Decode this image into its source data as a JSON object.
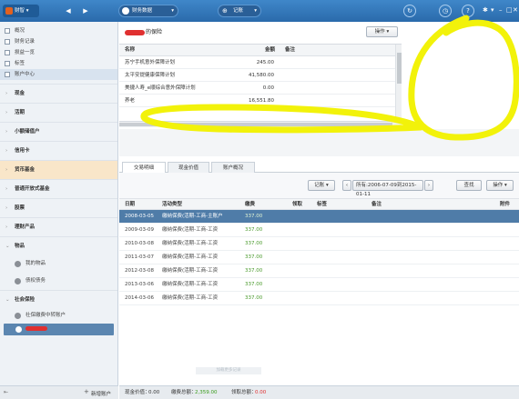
{
  "topbar": {
    "app_name": "财智",
    "workspace": "财务数据",
    "record": "记账",
    "colors": {
      "bar": "#3278bd",
      "accent": "#e2611f"
    }
  },
  "sidebar": {
    "top_items": [
      {
        "label": "概况",
        "icon": "overview-icon"
      },
      {
        "label": "财务记录",
        "icon": "records-icon"
      },
      {
        "label": "损益一览",
        "icon": "profit-icon"
      },
      {
        "label": "标签",
        "icon": "tag-icon"
      },
      {
        "label": "账户中心",
        "icon": "account-center-icon"
      }
    ],
    "groups": [
      {
        "label": "现金"
      },
      {
        "label": "活期"
      },
      {
        "label": "小额储值户"
      },
      {
        "label": "信用卡"
      },
      {
        "label": "货币基金"
      },
      {
        "label": "普通开放式基金"
      },
      {
        "label": "股票"
      },
      {
        "label": "理财产品"
      }
    ],
    "goods_group": {
      "label": "物品",
      "items": [
        "我的物品",
        "债权债务"
      ]
    },
    "social_group": {
      "label": "社会保险",
      "items": [
        "社保缴费中转账户"
      ]
    },
    "footer_add": "新增账户"
  },
  "account_panel": {
    "title_suffix": "的保险",
    "action_button": "操作",
    "columns": [
      "名称",
      "金额",
      "备注"
    ],
    "rows": [
      {
        "name": "苏宁手机意外保障计划",
        "amount": "245.00"
      },
      {
        "name": "太平安提健康保障计划",
        "amount": "41,580.00"
      },
      {
        "name": "美捷人寿_e顺综合意外保障计划",
        "amount": "0.00"
      },
      {
        "name": "养老",
        "amount": "16,551.80"
      }
    ]
  },
  "tabs": [
    "交易明细",
    "现金价值",
    "账户概况"
  ],
  "toolbar": {
    "record_button": "记账",
    "date_range": "所有:2006-07-09到2015-01-11",
    "search_button": "查找",
    "action_button": "操作"
  },
  "transactions": {
    "columns": [
      "日期",
      "活动类型",
      "缴费",
      "领取",
      "标签",
      "备注",
      "附件"
    ],
    "rows": [
      {
        "date": "2008-03-05",
        "type": "缴纳保费(活期-工商-主账户",
        "amount": "337.00",
        "selected": true
      },
      {
        "date": "2009-03-09",
        "type": "缴纳保费(活期-工商-工资",
        "amount": "337.00"
      },
      {
        "date": "2010-03-08",
        "type": "缴纳保费(活期-工商-工资",
        "amount": "337.00"
      },
      {
        "date": "2011-03-07",
        "type": "缴纳保费(活期-工商-工资",
        "amount": "337.00"
      },
      {
        "date": "2012-03-08",
        "type": "缴纳保费(活期-工商-工资",
        "amount": "337.00"
      },
      {
        "date": "2013-03-06",
        "type": "缴纳保费(活期-工商-工资",
        "amount": "337.00"
      },
      {
        "date": "2014-03-06",
        "type": "缴纳保费(活期-工商-工资",
        "amount": "337.00"
      }
    ]
  },
  "empty_hint": "加载更多记录",
  "status": {
    "cash_value_label": "现金价值：",
    "cash_value": "0.00",
    "premium_label": "缴费总额：",
    "premium": "2,359.00",
    "claim_label": "领取总额：",
    "claim": "0.00"
  }
}
